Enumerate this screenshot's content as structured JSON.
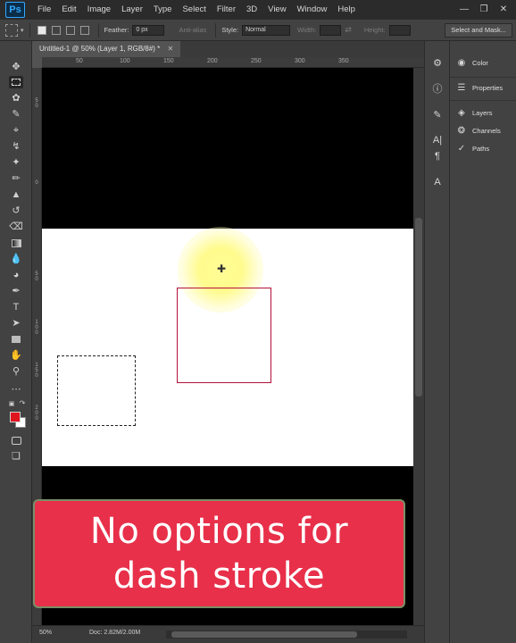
{
  "app": {
    "logo": "Ps",
    "menu": [
      "File",
      "Edit",
      "Image",
      "Layer",
      "Type",
      "Select",
      "Filter",
      "3D",
      "View",
      "Window",
      "Help"
    ],
    "window_controls": [
      "minimize-icon",
      "restore-icon",
      "close-icon"
    ]
  },
  "options": {
    "feather_label": "Feather:",
    "feather_value": "0 px",
    "antialias_label": "Anti-alias",
    "style_label": "Style:",
    "style_value": "Normal",
    "width_label": "Width:",
    "height_label": "Height:",
    "select_mask": "Select and Mask..."
  },
  "document": {
    "tab_title": "Untitled-1 @ 50% (Layer 1, RGB/8#) *",
    "ruler_top": [
      "50",
      "100",
      "150",
      "200",
      "250",
      "300",
      "350"
    ],
    "ruler_left": [
      "50",
      "0",
      "50",
      "100",
      "150",
      "200"
    ]
  },
  "status": {
    "zoom": "50%",
    "doc_size": "Doc: 2.82M/2.00M"
  },
  "panels": {
    "color": "Color",
    "properties": "Properties",
    "layers": "Layers",
    "channels": "Channels",
    "paths": "Paths"
  },
  "caption": {
    "line1": "No options for",
    "line2": "dash stroke"
  },
  "colors": {
    "foreground": "#e0141e",
    "background": "#ffffff",
    "caption_bg": "#e8304a"
  }
}
